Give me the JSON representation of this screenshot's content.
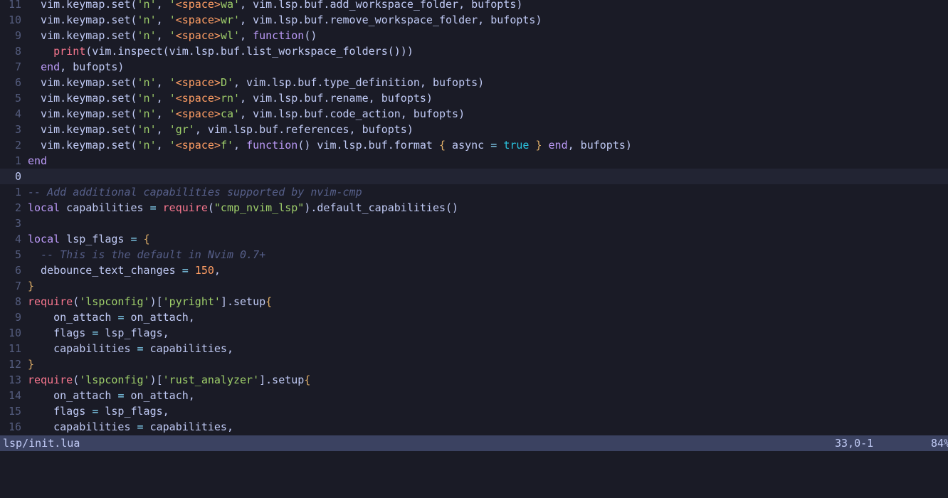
{
  "theme": {
    "background": "#1a1b26",
    "current_line": "#222433",
    "statusline": "#3b4261"
  },
  "lines": [
    {
      "num": "11",
      "tokens": [
        {
          "t": "  vim.keymap.set(",
          "c": "text"
        },
        {
          "t": "'n'",
          "c": "str"
        },
        {
          "t": ", ",
          "c": "text"
        },
        {
          "t": "'",
          "c": "str"
        },
        {
          "t": "<space>",
          "c": "esc"
        },
        {
          "t": "wa'",
          "c": "str"
        },
        {
          "t": ", vim.lsp.buf.add_workspace_folder, bufopts)",
          "c": "text"
        }
      ]
    },
    {
      "num": "10",
      "tokens": [
        {
          "t": "  vim.keymap.set(",
          "c": "text"
        },
        {
          "t": "'n'",
          "c": "str"
        },
        {
          "t": ", ",
          "c": "text"
        },
        {
          "t": "'",
          "c": "str"
        },
        {
          "t": "<space>",
          "c": "esc"
        },
        {
          "t": "wr'",
          "c": "str"
        },
        {
          "t": ", vim.lsp.buf.remove_workspace_folder, bufopts)",
          "c": "text"
        }
      ]
    },
    {
      "num": "9",
      "tokens": [
        {
          "t": "  vim.keymap.set(",
          "c": "text"
        },
        {
          "t": "'n'",
          "c": "str"
        },
        {
          "t": ", ",
          "c": "text"
        },
        {
          "t": "'",
          "c": "str"
        },
        {
          "t": "<space>",
          "c": "esc"
        },
        {
          "t": "wl'",
          "c": "str"
        },
        {
          "t": ", ",
          "c": "text"
        },
        {
          "t": "function",
          "c": "kw"
        },
        {
          "t": "()",
          "c": "text"
        }
      ]
    },
    {
      "num": "8",
      "tokens": [
        {
          "t": "    ",
          "c": "text"
        },
        {
          "t": "print",
          "c": "builtin"
        },
        {
          "t": "(vim.inspect(vim.lsp.buf.list_workspace_folders()))",
          "c": "text"
        }
      ]
    },
    {
      "num": "7",
      "tokens": [
        {
          "t": "  ",
          "c": "text"
        },
        {
          "t": "end",
          "c": "kw"
        },
        {
          "t": ", bufopts)",
          "c": "text"
        }
      ]
    },
    {
      "num": "6",
      "tokens": [
        {
          "t": "  vim.keymap.set(",
          "c": "text"
        },
        {
          "t": "'n'",
          "c": "str"
        },
        {
          "t": ", ",
          "c": "text"
        },
        {
          "t": "'",
          "c": "str"
        },
        {
          "t": "<space>",
          "c": "esc"
        },
        {
          "t": "D'",
          "c": "str"
        },
        {
          "t": ", vim.lsp.buf.type_definition, bufopts)",
          "c": "text"
        }
      ]
    },
    {
      "num": "5",
      "tokens": [
        {
          "t": "  vim.keymap.set(",
          "c": "text"
        },
        {
          "t": "'n'",
          "c": "str"
        },
        {
          "t": ", ",
          "c": "text"
        },
        {
          "t": "'",
          "c": "str"
        },
        {
          "t": "<space>",
          "c": "esc"
        },
        {
          "t": "rn'",
          "c": "str"
        },
        {
          "t": ", vim.lsp.buf.rename, bufopts)",
          "c": "text"
        }
      ]
    },
    {
      "num": "4",
      "tokens": [
        {
          "t": "  vim.keymap.set(",
          "c": "text"
        },
        {
          "t": "'n'",
          "c": "str"
        },
        {
          "t": ", ",
          "c": "text"
        },
        {
          "t": "'",
          "c": "str"
        },
        {
          "t": "<space>",
          "c": "esc"
        },
        {
          "t": "ca'",
          "c": "str"
        },
        {
          "t": ", vim.lsp.buf.code_action, bufopts)",
          "c": "text"
        }
      ]
    },
    {
      "num": "3",
      "tokens": [
        {
          "t": "  vim.keymap.set(",
          "c": "text"
        },
        {
          "t": "'n'",
          "c": "str"
        },
        {
          "t": ", ",
          "c": "text"
        },
        {
          "t": "'gr'",
          "c": "str"
        },
        {
          "t": ", vim.lsp.buf.references, bufopts)",
          "c": "text"
        }
      ]
    },
    {
      "num": "2",
      "tokens": [
        {
          "t": "  vim.keymap.set(",
          "c": "text"
        },
        {
          "t": "'n'",
          "c": "str"
        },
        {
          "t": ", ",
          "c": "text"
        },
        {
          "t": "'",
          "c": "str"
        },
        {
          "t": "<space>",
          "c": "esc"
        },
        {
          "t": "f'",
          "c": "str"
        },
        {
          "t": ", ",
          "c": "text"
        },
        {
          "t": "function",
          "c": "kw"
        },
        {
          "t": "() vim.lsp.buf.format ",
          "c": "text"
        },
        {
          "t": "{",
          "c": "brace"
        },
        {
          "t": " async ",
          "c": "text"
        },
        {
          "t": "=",
          "c": "op"
        },
        {
          "t": " ",
          "c": "text"
        },
        {
          "t": "true",
          "c": "bool"
        },
        {
          "t": " ",
          "c": "text"
        },
        {
          "t": "}",
          "c": "brace"
        },
        {
          "t": " ",
          "c": "text"
        },
        {
          "t": "end",
          "c": "kw"
        },
        {
          "t": ", bufopts)",
          "c": "text"
        }
      ]
    },
    {
      "num": "1",
      "tokens": [
        {
          "t": "end",
          "c": "kw"
        }
      ]
    },
    {
      "num": "0",
      "current": true,
      "tokens": []
    },
    {
      "num": "1",
      "tokens": [
        {
          "t": "-- Add additional capabilities supported by nvim-cmp",
          "c": "comment"
        }
      ]
    },
    {
      "num": "2",
      "tokens": [
        {
          "t": "local",
          "c": "kw"
        },
        {
          "t": " capabilities ",
          "c": "text"
        },
        {
          "t": "=",
          "c": "op"
        },
        {
          "t": " ",
          "c": "text"
        },
        {
          "t": "require",
          "c": "builtin"
        },
        {
          "t": "(",
          "c": "text"
        },
        {
          "t": "\"cmp_nvim_lsp\"",
          "c": "str"
        },
        {
          "t": ").default_capabilities()",
          "c": "text"
        }
      ]
    },
    {
      "num": "3",
      "tokens": []
    },
    {
      "num": "4",
      "tokens": [
        {
          "t": "local",
          "c": "kw"
        },
        {
          "t": " lsp_flags ",
          "c": "text"
        },
        {
          "t": "=",
          "c": "op"
        },
        {
          "t": " ",
          "c": "text"
        },
        {
          "t": "{",
          "c": "brace"
        }
      ]
    },
    {
      "num": "5",
      "tokens": [
        {
          "t": "  ",
          "c": "text"
        },
        {
          "t": "-- This is the default in Nvim 0.7+",
          "c": "comment"
        }
      ]
    },
    {
      "num": "6",
      "tokens": [
        {
          "t": "  debounce_text_changes ",
          "c": "text"
        },
        {
          "t": "=",
          "c": "op"
        },
        {
          "t": " ",
          "c": "text"
        },
        {
          "t": "150",
          "c": "num"
        },
        {
          "t": ",",
          "c": "text"
        }
      ]
    },
    {
      "num": "7",
      "tokens": [
        {
          "t": "}",
          "c": "brace"
        }
      ]
    },
    {
      "num": "8",
      "tokens": [
        {
          "t": "require",
          "c": "builtin"
        },
        {
          "t": "(",
          "c": "text"
        },
        {
          "t": "'lspconfig'",
          "c": "str"
        },
        {
          "t": ")[",
          "c": "text"
        },
        {
          "t": "'pyright'",
          "c": "str"
        },
        {
          "t": "].setup",
          "c": "text"
        },
        {
          "t": "{",
          "c": "brace"
        }
      ]
    },
    {
      "num": "9",
      "tokens": [
        {
          "t": "    on_attach ",
          "c": "text"
        },
        {
          "t": "=",
          "c": "op"
        },
        {
          "t": " on_attach,",
          "c": "text"
        }
      ]
    },
    {
      "num": "10",
      "tokens": [
        {
          "t": "    flags ",
          "c": "text"
        },
        {
          "t": "=",
          "c": "op"
        },
        {
          "t": " lsp_flags,",
          "c": "text"
        }
      ]
    },
    {
      "num": "11",
      "tokens": [
        {
          "t": "    capabilities ",
          "c": "text"
        },
        {
          "t": "=",
          "c": "op"
        },
        {
          "t": " capabilities,",
          "c": "text"
        }
      ]
    },
    {
      "num": "12",
      "tokens": [
        {
          "t": "}",
          "c": "brace"
        }
      ]
    },
    {
      "num": "13",
      "tokens": [
        {
          "t": "require",
          "c": "builtin"
        },
        {
          "t": "(",
          "c": "text"
        },
        {
          "t": "'lspconfig'",
          "c": "str"
        },
        {
          "t": ")[",
          "c": "text"
        },
        {
          "t": "'rust_analyzer'",
          "c": "str"
        },
        {
          "t": "].setup",
          "c": "text"
        },
        {
          "t": "{",
          "c": "brace"
        }
      ]
    },
    {
      "num": "14",
      "tokens": [
        {
          "t": "    on_attach ",
          "c": "text"
        },
        {
          "t": "=",
          "c": "op"
        },
        {
          "t": " on_attach,",
          "c": "text"
        }
      ]
    },
    {
      "num": "15",
      "tokens": [
        {
          "t": "    flags ",
          "c": "text"
        },
        {
          "t": "=",
          "c": "op"
        },
        {
          "t": " lsp_flags,",
          "c": "text"
        }
      ]
    },
    {
      "num": "16",
      "tokens": [
        {
          "t": "    capabilities ",
          "c": "text"
        },
        {
          "t": "=",
          "c": "op"
        },
        {
          "t": " capabilities,",
          "c": "text"
        }
      ]
    }
  ],
  "statusline": {
    "filename": "lsp/init.lua",
    "position": "33,0-1",
    "scroll_percent": "84%"
  }
}
